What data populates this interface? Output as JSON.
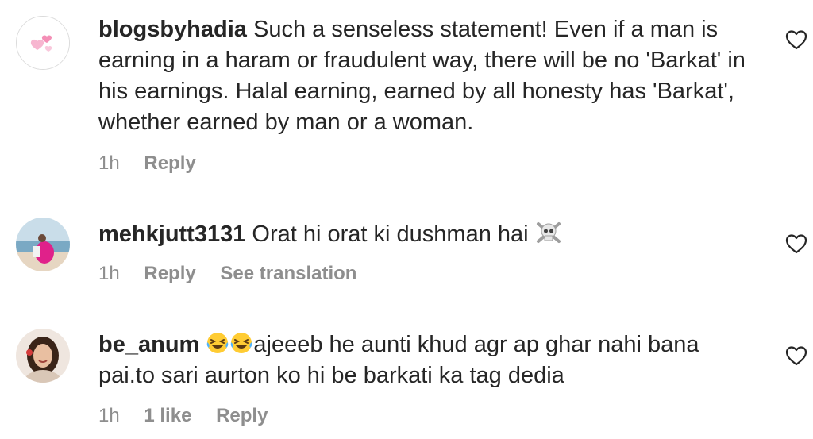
{
  "comments": [
    {
      "username": "blogsbyhadia",
      "text": "Such a senseless statement! Even if a man is earning in a haram or fraudulent way, there will be no 'Barkat' in his earnings. Halal earning, earned by all honesty has 'Barkat', whether earned by man or a woman.",
      "time": "1h",
      "reply_label": "Reply",
      "avatar_icon": "pink-hearts-icon"
    },
    {
      "username": "mehkjutt3131",
      "text": "Orat hi orat ki dushman hai",
      "emoji_after": "skull-crossbones-icon",
      "time": "1h",
      "reply_label": "Reply",
      "translation_label": "See translation",
      "avatar_icon": "beach-photo-avatar"
    },
    {
      "username": "be_anum",
      "emoji_before": "laughing-tears-icon",
      "text": "ajeeeb he aunti khud agr ap ghar nahi bana pai.to sari aurton ko hi be barkati ka tag dedia",
      "time": "1h",
      "likes": "1 like",
      "reply_label": "Reply",
      "avatar_icon": "woman-photo-avatar"
    }
  ],
  "colors": {
    "text": "#262626",
    "meta": "#8e8e8e",
    "heart_pink": "#f7a8c4"
  }
}
